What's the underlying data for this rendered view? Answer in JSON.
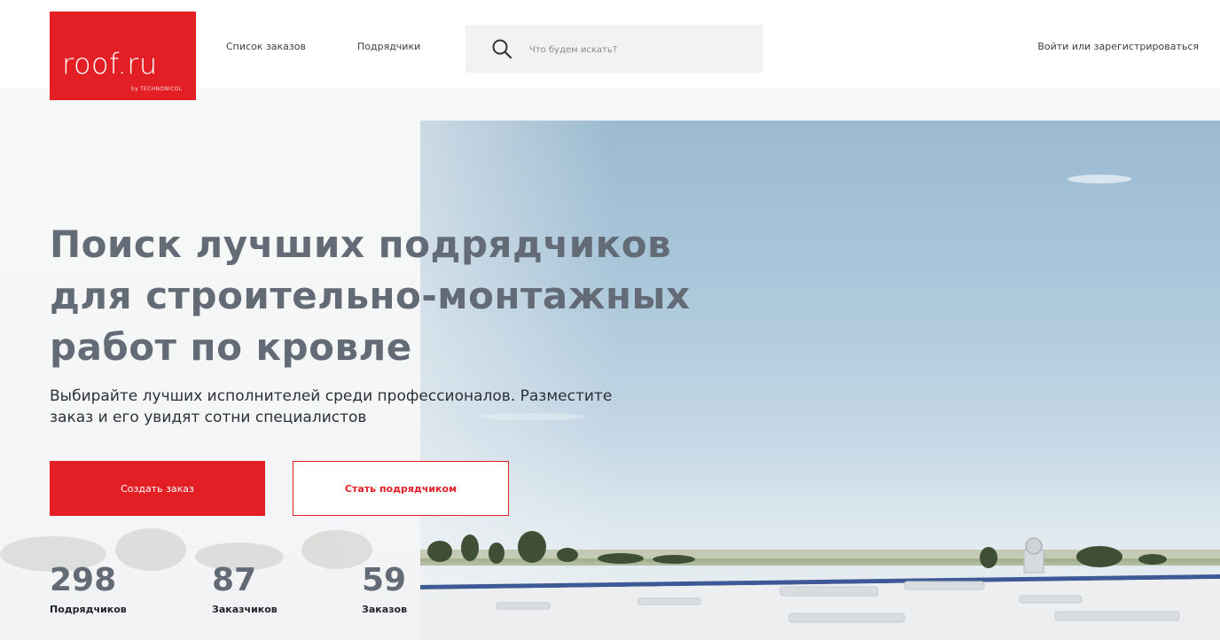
{
  "header": {
    "logo": {
      "text": "roof.ru",
      "sub": "by TECHNONICOL"
    },
    "nav": [
      {
        "label": "Список заказов"
      },
      {
        "label": "Подрядчики"
      }
    ],
    "search": {
      "placeholder": "Что будем искать?",
      "icon": "search-icon"
    },
    "login_label": "Войти или зарегистрироваться"
  },
  "hero": {
    "title_lines": [
      "Поиск лучших подрядчиков",
      "для строительно-монтажных",
      "работ по кровле"
    ],
    "subtitle_lines": [
      "Выбирайте лучших исполнителей среди профессионалов. Разместите",
      "заказ и его увидят сотни специалистов"
    ],
    "primary_button": "Создать заказ",
    "secondary_button": "Стать подрядчиком"
  },
  "stats": [
    {
      "value": "298",
      "label": "Подрядчиков"
    },
    {
      "value": "87",
      "label": "Заказчиков"
    },
    {
      "value": "59",
      "label": "Заказов"
    }
  ],
  "colors": {
    "brand_red": "#e31e24",
    "title_gray": "#636b76",
    "text_dark": "#2c3038",
    "search_bg": "#f2f2f2"
  }
}
